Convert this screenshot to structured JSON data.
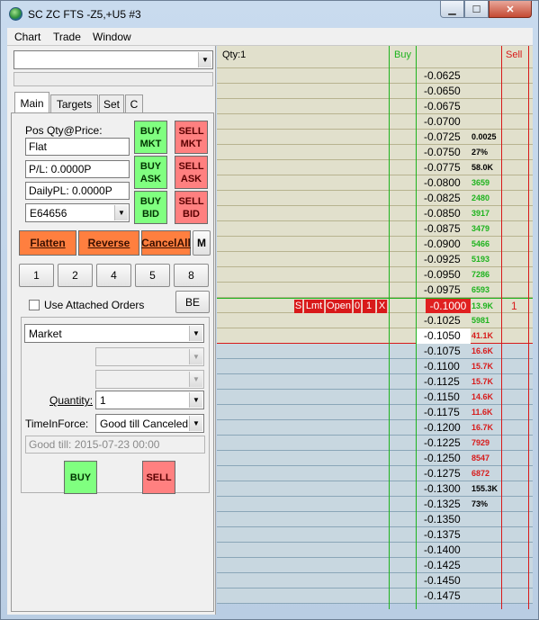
{
  "window": {
    "title": "SC ZC FTS -Z5,+U5  #3",
    "close_glyph": "✕",
    "min_glyph": "▁",
    "max_glyph": "☐"
  },
  "menu": [
    "Chart",
    "Trade",
    "Window"
  ],
  "panel": {
    "symbol_value": "",
    "tabs": [
      "Main",
      "Targets",
      "Set",
      "C"
    ],
    "pos_label": "Pos Qty@Price:",
    "pos_value": "Flat",
    "pl_value": "P/L: 0.0000P",
    "daily_pl_value": "DailyPL: 0.0000P",
    "account": "E64656",
    "buy_mkt": "BUY MKT",
    "sell_mkt": "SELL MKT",
    "buy_ask": "BUY ASK",
    "sell_ask": "SELL ASK",
    "buy_bid": "BUY BID",
    "sell_bid": "SELL BID",
    "flatten": "Flatten",
    "reverse": "Reverse",
    "cancel_all": "CancelAll",
    "m": "M",
    "qty_buttons": [
      "1",
      "2",
      "4",
      "5",
      "8"
    ],
    "use_attached_orders": "Use Attached Orders",
    "be": "BE",
    "order_type": "Market",
    "quantity_label": "Quantity:",
    "quantity_value": "1",
    "tif_label": "TimeInForce:",
    "tif_value": "Good till Canceled",
    "good_till": "Good till: 2015-07-23 00:00",
    "buy": "BUY",
    "sell": "SELL"
  },
  "ladder": {
    "qty_label": "Qty:1",
    "buy_header": "Buy",
    "sell_header": "Sell",
    "order_badges": [
      "S",
      "Lmt",
      "Open",
      "0",
      "1",
      "X"
    ],
    "sell_count": "1",
    "rows": [
      {
        "price": "-0.0625",
        "vol": "",
        "c": ""
      },
      {
        "price": "-0.0650",
        "vol": "",
        "c": ""
      },
      {
        "price": "-0.0675",
        "vol": "",
        "c": ""
      },
      {
        "price": "-0.0700",
        "vol": "",
        "c": ""
      },
      {
        "price": "-0.0725",
        "vol": "0.0025",
        "c": "black"
      },
      {
        "price": "-0.0750",
        "vol": "27%",
        "c": "black"
      },
      {
        "price": "-0.0775",
        "vol": "58.0K",
        "c": "black"
      },
      {
        "price": "-0.0800",
        "vol": "3659",
        "c": "green"
      },
      {
        "price": "-0.0825",
        "vol": "2480",
        "c": "green"
      },
      {
        "price": "-0.0850",
        "vol": "3917",
        "c": "green"
      },
      {
        "price": "-0.0875",
        "vol": "3479",
        "c": "green"
      },
      {
        "price": "-0.0900",
        "vol": "5466",
        "c": "green"
      },
      {
        "price": "-0.0925",
        "vol": "5193",
        "c": "green"
      },
      {
        "price": "-0.0950",
        "vol": "7286",
        "c": "green"
      },
      {
        "price": "-0.0975",
        "vol": "6593",
        "c": "green"
      },
      {
        "price": "-0.1000",
        "vol": "13.9K",
        "c": "green"
      },
      {
        "price": "-0.1025",
        "vol": "5981",
        "c": "green"
      },
      {
        "price": "-0.1050",
        "vol": "41.1K",
        "c": "red"
      },
      {
        "price": "-0.1075",
        "vol": "16.6K",
        "c": "red"
      },
      {
        "price": "-0.1100",
        "vol": "15.7K",
        "c": "red"
      },
      {
        "price": "-0.1125",
        "vol": "15.7K",
        "c": "red"
      },
      {
        "price": "-0.1150",
        "vol": "14.6K",
        "c": "red"
      },
      {
        "price": "-0.1175",
        "vol": "11.6K",
        "c": "red"
      },
      {
        "price": "-0.1200",
        "vol": "16.7K",
        "c": "red"
      },
      {
        "price": "-0.1225",
        "vol": "7929",
        "c": "red"
      },
      {
        "price": "-0.1250",
        "vol": "8547",
        "c": "red"
      },
      {
        "price": "-0.1275",
        "vol": "6872",
        "c": "red"
      },
      {
        "price": "-0.1300",
        "vol": "155.3K",
        "c": "black"
      },
      {
        "price": "-0.1325",
        "vol": "73%",
        "c": "black"
      },
      {
        "price": "-0.1350",
        "vol": "",
        "c": ""
      },
      {
        "price": "-0.1375",
        "vol": "",
        "c": ""
      },
      {
        "price": "-0.1400",
        "vol": "",
        "c": ""
      },
      {
        "price": "-0.1425",
        "vol": "",
        "c": ""
      },
      {
        "price": "-0.1450",
        "vol": "",
        "c": ""
      },
      {
        "price": "-0.1475",
        "vol": "",
        "c": ""
      }
    ],
    "last_trade_index": 15,
    "current_index": 17
  }
}
